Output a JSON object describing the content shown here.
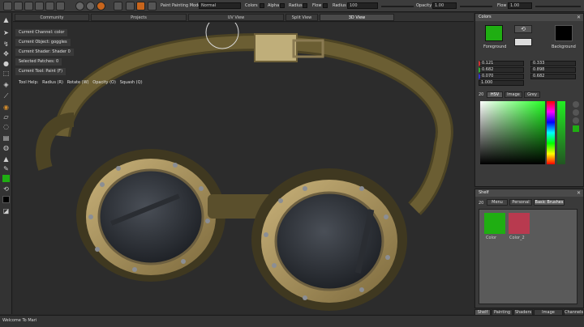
{
  "toolbar": {
    "paint_label": "Paint",
    "painting_mode_label": "Painting Mode:",
    "painting_mode_value": "Normal",
    "colors_label": "Colors",
    "alpha_label": "Alpha",
    "radius_label": "Radius",
    "flow_label": "Flow",
    "radius2_label": "Radius",
    "radius_value": "100",
    "opacity_label": "Opacity",
    "opacity_value": "1.00",
    "flow2_label": "Flow",
    "flow_value": "1.00"
  },
  "tabs": [
    {
      "label": "Community"
    },
    {
      "label": "Projects"
    },
    {
      "label": "UV View"
    },
    {
      "label": "Split View"
    },
    {
      "label": "3D View"
    }
  ],
  "viewport": {
    "hud": [
      "Current Channel: color",
      "Current Object: goggles",
      "Current Shader: Shader 0",
      "Selected Patches: 0",
      "Current Tool: Paint (F)"
    ],
    "tool_help": [
      "Tool Help:",
      "Radius (R)",
      "Rotate (W)",
      "Opacity (O)",
      "Squash (Q)"
    ]
  },
  "colors_panel": {
    "title": "Colors",
    "foreground_label": "Foreground",
    "background_label": "Background",
    "foreground_color": "#1fae12",
    "background_color": "#000000",
    "left_values": [
      "0.121",
      "0.682",
      "0.070",
      "1.000"
    ],
    "right_values": [
      "0.333",
      "0.898",
      "0.682"
    ],
    "tabs": [
      "HSV",
      "Image",
      "Grey"
    ],
    "tab_prefix": "20"
  },
  "shelf_panel": {
    "title": "Shelf",
    "tab_prefix": "20",
    "tabs": [
      "Menu",
      "Personal",
      "Basic Brushes"
    ],
    "swatches": [
      {
        "label": "Color",
        "color": "#1fae12"
      },
      {
        "label": "Color_2",
        "color": "#b83a4f"
      }
    ]
  },
  "bottom_tabs": [
    "Shelf",
    "Painting",
    "Shaders",
    "Image Manager",
    "Channels"
  ],
  "status": {
    "message": "Welcome To Mari"
  }
}
